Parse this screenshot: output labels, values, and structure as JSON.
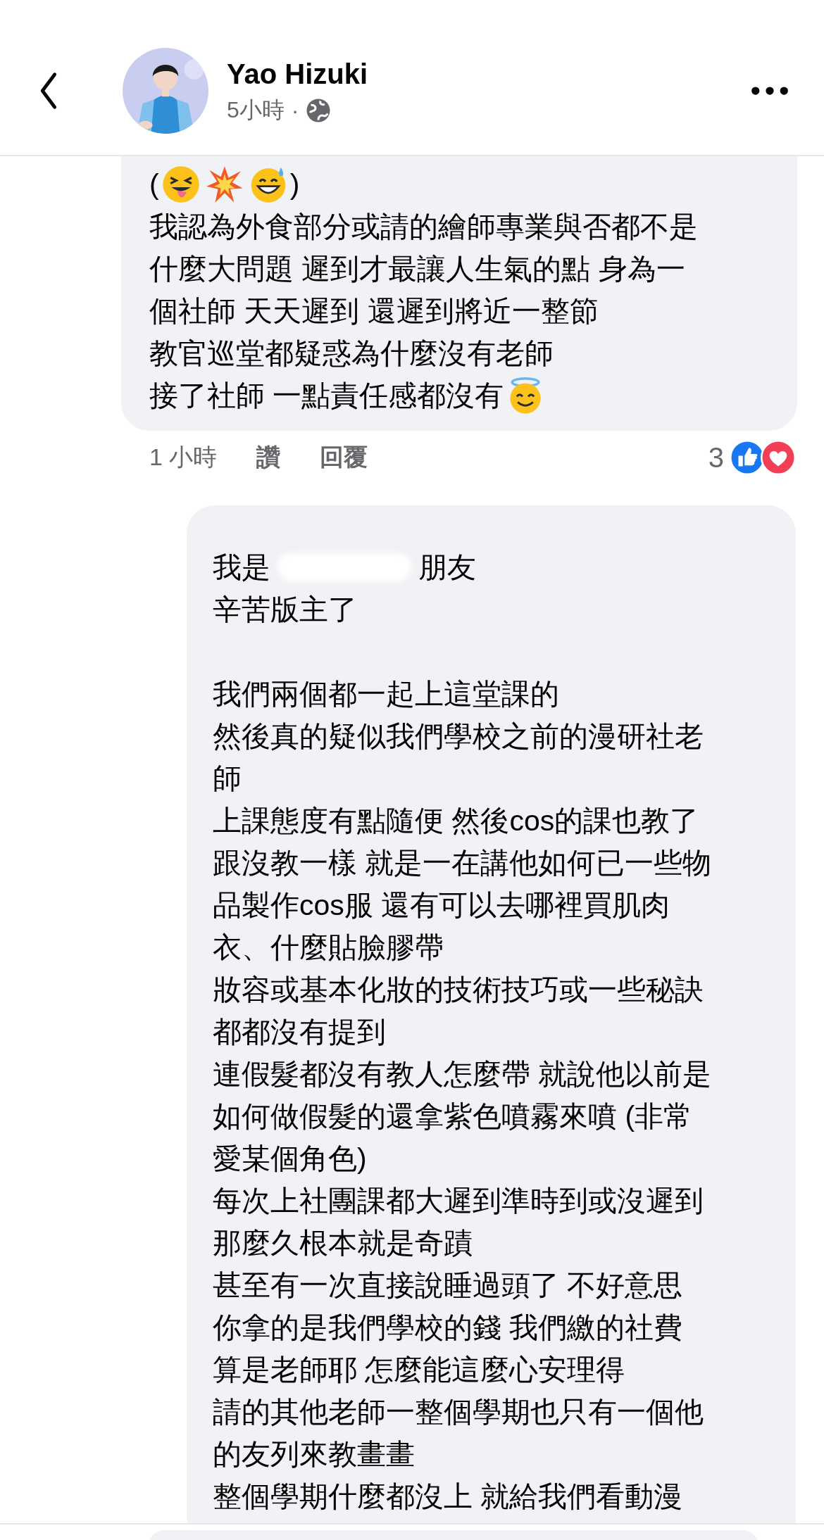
{
  "header": {
    "name": "Yao Hizuki",
    "time": "5小時",
    "separator": "·"
  },
  "comments": [
    {
      "lines": [
        {
          "kind": "mixed",
          "parts": [
            {
              "kind": "text",
              "text": "("
            },
            {
              "kind": "emoji"
            },
            {
              "kind": "emoji"
            },
            {
              "kind": "emoji"
            },
            {
              "kind": "text",
              "text": ")"
            }
          ]
        },
        {
          "kind": "text",
          "text": "我認為外食部分或請的繪師專業與否都不是"
        },
        {
          "kind": "text",
          "text": "什麼大問題  遲到才最讓人生氣的點 身為一"
        },
        {
          "kind": "text",
          "text": "個社師 天天遲到 還遲到將近一整節"
        },
        {
          "kind": "text",
          "text": "教官巡堂都疑惑為什麼沒有老師"
        },
        {
          "kind": "mixed",
          "parts": [
            {
              "kind": "text",
              "text": "接了社師 一點責任感都沒有"
            },
            {
              "kind": "emoji"
            }
          ]
        }
      ],
      "time": "1 小時",
      "actions": [
        "讚",
        "回覆"
      ],
      "reaction_count": "3"
    },
    {
      "lines": [
        {
          "kind": "mixed",
          "parts": [
            {
              "kind": "text",
              "text": "我是"
            },
            {
              "kind": "gap"
            },
            {
              "kind": "text",
              "text": "朋友"
            }
          ]
        },
        {
          "kind": "text",
          "text": "辛苦版主了"
        },
        {
          "kind": "blank"
        },
        {
          "kind": "text",
          "text": "我們兩個都一起上這堂課的"
        },
        {
          "kind": "text",
          "text": "然後真的疑似我們學校之前的漫研社老"
        },
        {
          "kind": "text",
          "text": "師"
        },
        {
          "kind": "text",
          "text": "上課態度有點隨便 然後cos的課也教了"
        },
        {
          "kind": "text",
          "text": "跟沒教一樣 就是一在講他如何已一些物"
        },
        {
          "kind": "text",
          "text": "品製作cos服 還有可以去哪裡買肌肉"
        },
        {
          "kind": "text",
          "text": "衣、什麼貼臉膠帶"
        },
        {
          "kind": "text",
          "text": "妝容或基本化妝的技術技巧或一些秘訣"
        },
        {
          "kind": "text",
          "text": "都都沒有提到"
        },
        {
          "kind": "text",
          "text": "連假髮都沒有教人怎麼帶 就說他以前是"
        },
        {
          "kind": "text",
          "text": "如何做假髮的還拿紫色噴霧來噴 (非常"
        },
        {
          "kind": "text",
          "text": "愛某個角色)"
        },
        {
          "kind": "text",
          "text": "每次上社團課都大遲到準時到或沒遲到"
        },
        {
          "kind": "text",
          "text": "那麼久根本就是奇蹟"
        },
        {
          "kind": "text",
          "text": "甚至有一次直接說睡過頭了 不好意思"
        },
        {
          "kind": "text",
          "text": "你拿的是我們學校的錢 我們繳的社費"
        },
        {
          "kind": "text",
          "text": "算是老師耶 怎麼能這麼心安理得"
        },
        {
          "kind": "text",
          "text": "請的其他老師一整個學期也只有一個他"
        },
        {
          "kind": "text",
          "text": "的友列來教畫畫"
        },
        {
          "kind": "text",
          "text": "整個學期什麼都沒上 就給我們看動漫"
        }
      ]
    }
  ]
}
